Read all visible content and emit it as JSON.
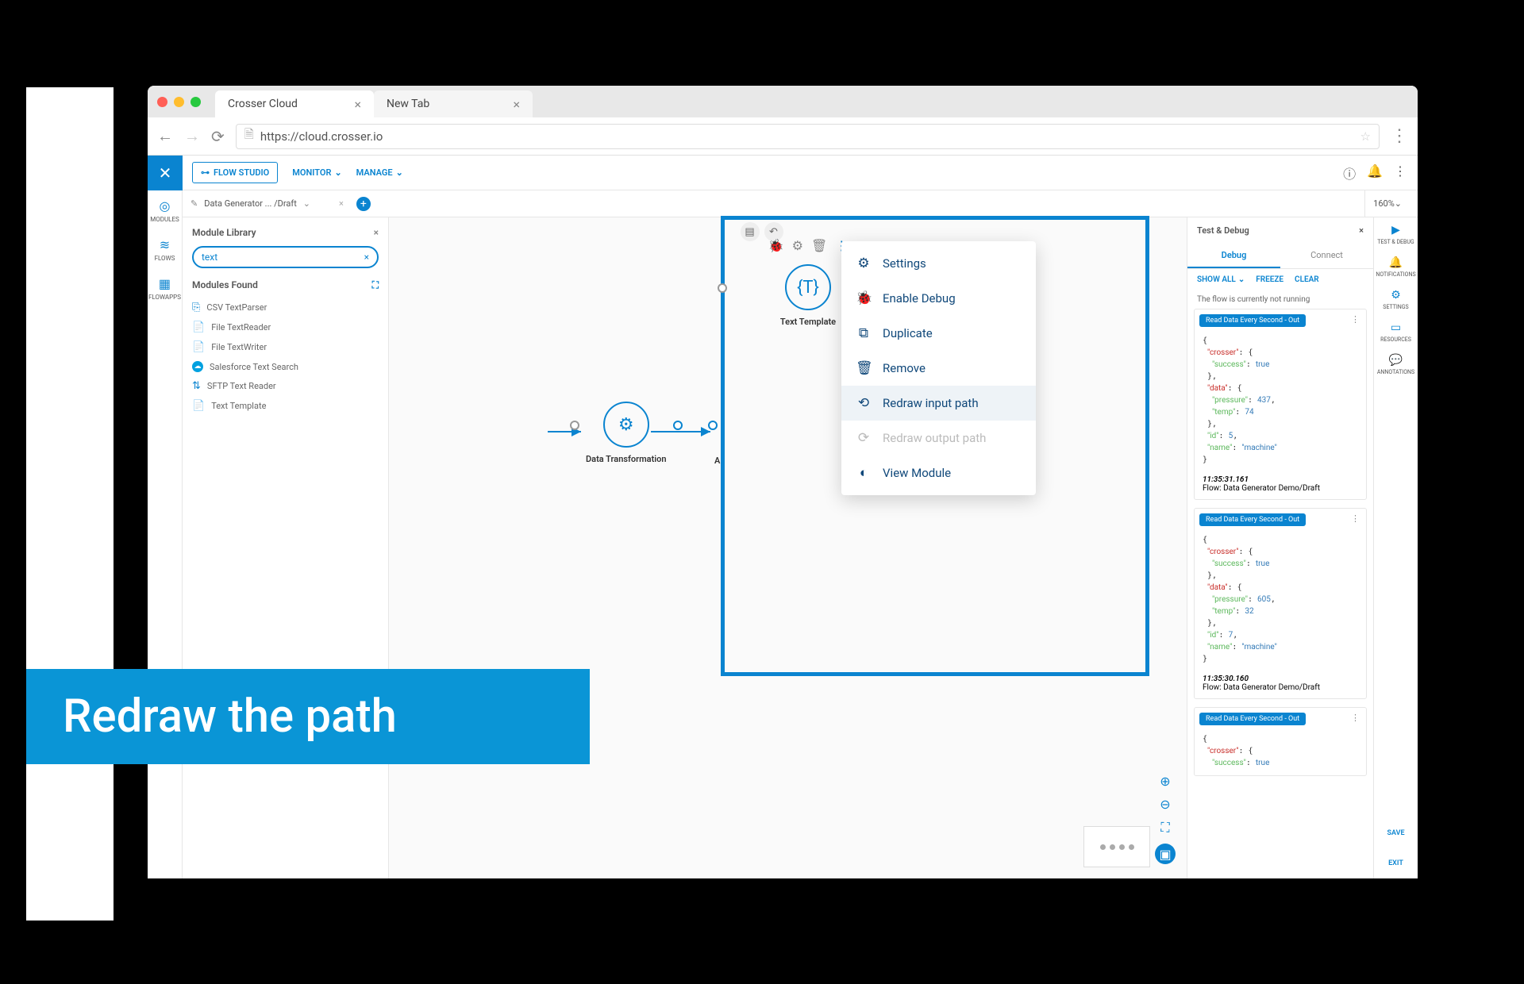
{
  "browser": {
    "tabs": [
      {
        "label": "Crosser Cloud",
        "active": true
      },
      {
        "label": "New Tab",
        "active": false
      }
    ],
    "url": "https://cloud.crosser.io"
  },
  "header": {
    "flow_studio": "FLOW STUDIO",
    "menus": [
      "MONITOR",
      "MANAGE"
    ]
  },
  "crumb": {
    "label": "Data Generator ... /Draft",
    "zoom": "160%"
  },
  "left_rail": [
    {
      "icon": "◎",
      "label": "MODULES"
    },
    {
      "icon": "≋",
      "label": "FLOWS"
    },
    {
      "icon": "▦",
      "label": "FLOWAPPS"
    }
  ],
  "module_library": {
    "title": "Module Library",
    "search": "text",
    "found_title": "Modules Found",
    "items": [
      {
        "icon": "⎘",
        "label": "CSV TextParser"
      },
      {
        "icon": "📄",
        "label": "File TextReader"
      },
      {
        "icon": "📄",
        "label": "File TextWriter"
      },
      {
        "icon": "☁",
        "label": "Salesforce Text Search",
        "sf": true
      },
      {
        "icon": "⇅",
        "label": "SFTP Text Reader"
      },
      {
        "icon": "📄",
        "label": "Text Template"
      }
    ]
  },
  "canvas": {
    "node1": "Data Transformation",
    "node2_partial": "A",
    "selected_node": "Text Template"
  },
  "context_menu": [
    {
      "icon": "⚙",
      "label": "Settings"
    },
    {
      "icon": "🐞",
      "label": "Enable Debug"
    },
    {
      "icon": "⧉",
      "label": "Duplicate"
    },
    {
      "icon": "🗑",
      "label": "Remove"
    },
    {
      "icon": "⟲",
      "label": "Redraw input path",
      "hl": true
    },
    {
      "icon": "⟳",
      "label": "Redraw output path",
      "disabled": true
    },
    {
      "icon": "◐",
      "label": "View Module"
    }
  ],
  "test_debug": {
    "title": "Test & Debug",
    "tabs": [
      "Debug",
      "Connect"
    ],
    "actions": {
      "show_all": "SHOW ALL",
      "freeze": "FREEZE",
      "clear": "CLEAR"
    },
    "status": "The flow is currently not running",
    "cards": [
      {
        "chip": "Read Data Every Second - Out",
        "json": {
          "crosser": {
            "success": true
          },
          "data": {
            "pressure": 437,
            "temp": 74
          },
          "id": 5,
          "name": "machine"
        },
        "time": "11:35:31.161",
        "flow": "Flow: Data Generator Demo/Draft"
      },
      {
        "chip": "Read Data Every Second - Out",
        "json": {
          "crosser": {
            "success": true
          },
          "data": {
            "pressure": 605,
            "temp": 32
          },
          "id": 7,
          "name": "machine"
        },
        "time": "11:35:30.160",
        "flow": "Flow: Data Generator Demo/Draft"
      },
      {
        "chip": "Read Data Every Second - Out",
        "partial": {
          "crosser": {
            "success": true
          }
        }
      }
    ]
  },
  "right_rail": [
    {
      "icon": "▶",
      "label": "TEST & DEBUG"
    },
    {
      "icon": "🔔",
      "label": "NOTIFICATIONS"
    },
    {
      "icon": "⚙",
      "label": "SETTINGS"
    },
    {
      "icon": "▭",
      "label": "RESOURCES"
    },
    {
      "icon": "💬",
      "label": "ANNOTATIONS"
    }
  ],
  "right_rail_buttons": [
    "SAVE",
    "EXIT"
  ],
  "banner": "Redraw the path"
}
